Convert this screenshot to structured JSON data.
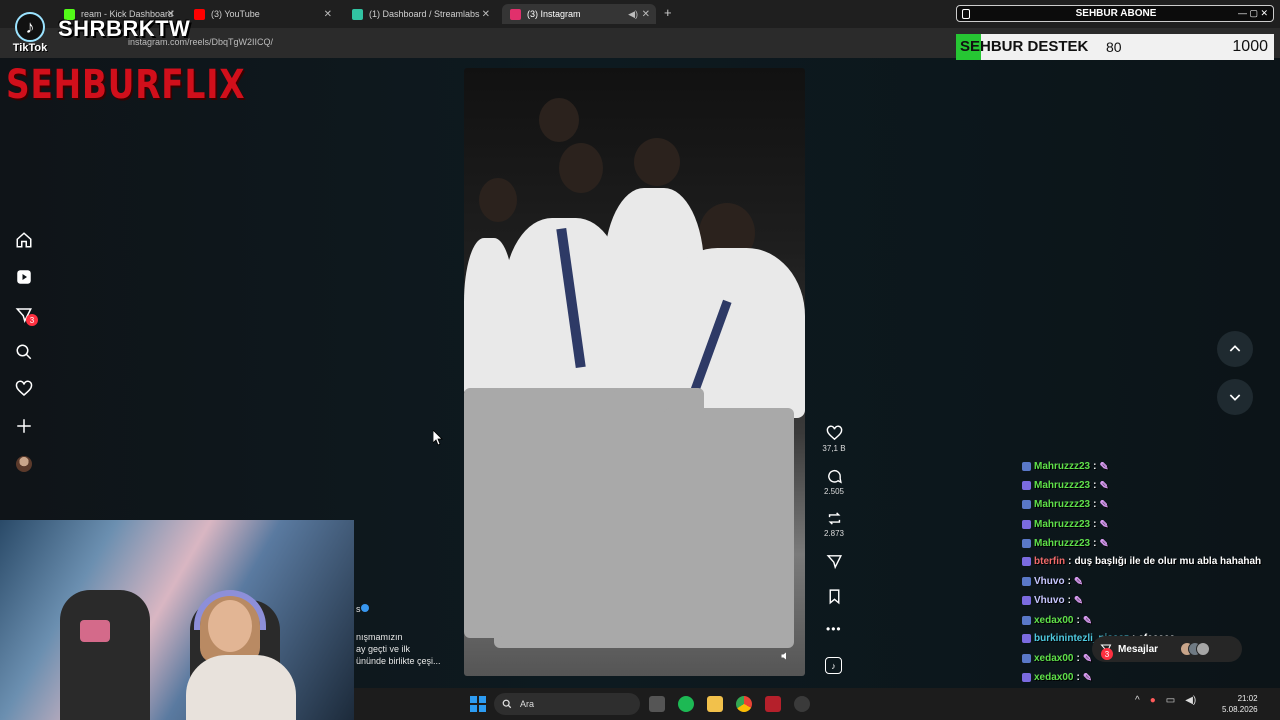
{
  "browser": {
    "tabs": [
      {
        "label": "ream - Kick Dashboard",
        "favicon_color": "#53fc18",
        "active": false
      },
      {
        "label": "(3) YouTube",
        "favicon_color": "#ff0000",
        "active": false
      },
      {
        "label": "(1) Dashboard / Streamlabs",
        "favicon_color": "#31c3a2",
        "active": false
      },
      {
        "label": "(3) Instagram",
        "favicon_color": "#e1306c",
        "active": true
      }
    ],
    "new_tab": "+",
    "url": "instagram.com/reels/DbqTgW2IICQ/"
  },
  "overlay": {
    "tiktok_label": "TikTok",
    "tiktok_handle": "SHRBRKTW",
    "brand": "SEHBURFLIX",
    "sub_bar_label": "SEHBUR ABONE",
    "goal": {
      "title": "SEHBUR DESTEK",
      "current": "80",
      "target": "1000",
      "progress": 0.08,
      "fill_color": "#26c633"
    }
  },
  "sidebar": {
    "items": [
      "home",
      "reels",
      "messages",
      "search",
      "notifications",
      "create",
      "profile"
    ],
    "messages_badge": "3"
  },
  "reel": {
    "actions": {
      "likes": "37,1 B",
      "comments": "2.505",
      "reposts": "2.873"
    },
    "caption": {
      "user_suffix": "s",
      "lines": [
        "nışmamızın",
        "ay geçti ve ilk",
        "ününde birlikte çeşi..."
      ]
    }
  },
  "chat": {
    "messages": [
      {
        "user": "Mahruzzz23",
        "text": "",
        "color": "#5fe04a",
        "emote": true
      },
      {
        "user": "Mahruzzz23",
        "text": "",
        "color": "#5fe04a",
        "emote": true
      },
      {
        "user": "Mahruzzz23",
        "text": "",
        "color": "#5fe04a",
        "emote": true
      },
      {
        "user": "Mahruzzz23",
        "text": "",
        "color": "#5fe04a",
        "emote": true
      },
      {
        "user": "Mahruzzz23",
        "text": "",
        "color": "#5fe04a",
        "emote": true
      },
      {
        "user": "bterfin",
        "text": "duş başlığı ile de olur mu abla hahahah",
        "color": "#f06a6a",
        "emote": false
      },
      {
        "user": "Vhuvo",
        "text": "",
        "color": "#c7c7ff",
        "emote": true
      },
      {
        "user": "Vhuvo",
        "text": "",
        "color": "#c7c7ff",
        "emote": true
      },
      {
        "user": "xedax00",
        "text": "",
        "color": "#5fe04a",
        "emote": true
      },
      {
        "user": "burkinintezli_nisaaz",
        "text": "efeeeee",
        "color": "#4ec9e0",
        "emote": false
      },
      {
        "user": "xedax00",
        "text": "",
        "color": "#5fe04a",
        "emote": true
      },
      {
        "user": "xedax00",
        "text": "",
        "color": "#5fe04a",
        "emote": true
      },
      {
        "user": "xedax00",
        "text": "",
        "color": "#5fe04a",
        "emote": true
      }
    ],
    "messages_button": "Mesajlar",
    "messages_badge": "3"
  },
  "taskbar": {
    "search_placeholder": "Ara",
    "time": "21:02",
    "date": "5.08.2026"
  }
}
